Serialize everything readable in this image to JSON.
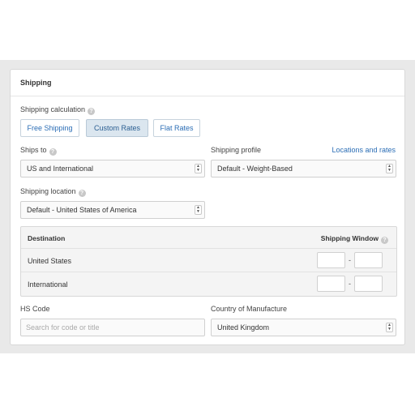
{
  "shipping": {
    "title": "Shipping",
    "calculation": {
      "label": "Shipping calculation",
      "options": [
        "Free Shipping",
        "Custom Rates",
        "Flat Rates"
      ],
      "selected": "Custom Rates"
    },
    "ships_to": {
      "label": "Ships to",
      "value": "US and International"
    },
    "profile": {
      "label": "Shipping profile",
      "value": "Default - Weight-Based",
      "link": "Locations and rates"
    },
    "location": {
      "label": "Shipping location",
      "value": "Default - United States of America"
    },
    "table": {
      "destination_header": "Destination",
      "window_header": "Shipping Window",
      "rows": [
        {
          "destination": "United States",
          "min": "",
          "max": ""
        },
        {
          "destination": "International",
          "min": "",
          "max": ""
        }
      ],
      "separator": "-"
    },
    "hs_code": {
      "label": "HS Code",
      "placeholder": "Search for code or title",
      "value": ""
    },
    "country": {
      "label": "Country of Manufacture",
      "value": "United Kingdom"
    }
  },
  "icons": {
    "help": "question-circle-icon",
    "select_arrows": "up-down-arrows-icon"
  },
  "colors": {
    "link": "#2a6db5",
    "active_button_bg": "#dbe6ef",
    "page_band": "#e9e9e9"
  }
}
